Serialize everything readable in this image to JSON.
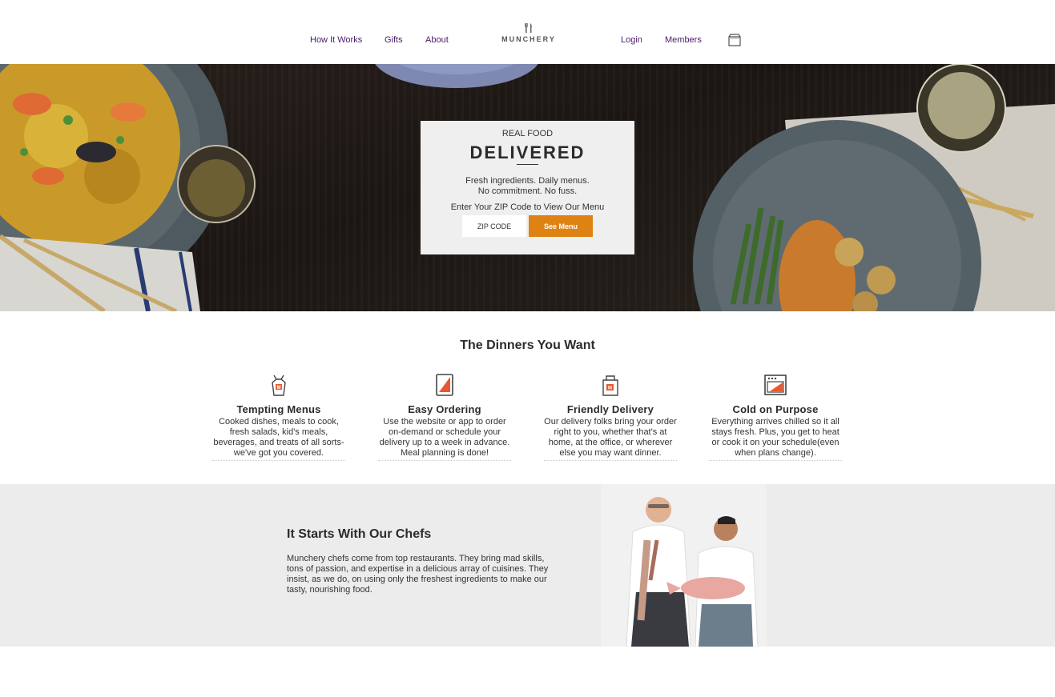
{
  "nav": {
    "left_links": [
      "How It Works",
      "Gifts",
      "About"
    ],
    "right_links": [
      "Login",
      "Members"
    ],
    "logo_text": "MUNCHERY",
    "cart_icon": "shopping-bag-icon"
  },
  "hero": {
    "kicker": "REAL FOOD",
    "headline": "DELIVERED",
    "tagline_1": "Fresh ingredients. Daily menus.",
    "tagline_2": "No commitment. No fuss.",
    "zip_prompt": "Enter Your ZIP Code to View Our Menu",
    "zip_placeholder": "ZIP CODE",
    "cta_label": "See Menu",
    "cta_color": "#de8214"
  },
  "dinners": {
    "title": "The Dinners You Want",
    "features": [
      {
        "icon": "apron-icon",
        "title": "Tempting Menus",
        "desc": "Cooked dishes, meals to cook, fresh salads, kid's meals, beverages, and treats of all sorts- we've got you covered."
      },
      {
        "icon": "tablet-icon",
        "title": "Easy Ordering",
        "desc": "Use the website or app to order on-demand or schedule your delivery up to a week in advance. Meal planning is done!"
      },
      {
        "icon": "delivery-bag-icon",
        "title": "Friendly Delivery",
        "desc": "Our delivery folks bring your order right to you, whether that's at home, at the office, or wherever else you may want dinner."
      },
      {
        "icon": "oven-icon",
        "title": "Cold on Purpose",
        "desc": "Everything arrives chilled so it all stays fresh. Plus, you get to heat or cook it on your schedule(even when plans change)."
      }
    ]
  },
  "chefs": {
    "title": "It Starts With Our Chefs",
    "body": "Munchery chefs come from top restaurants. They bring mad skills, tons of passion, and expertise in a delicious array of cuisines. They insist, as we do, on using only the freshest ingredients to make our tasty, nourishing food."
  },
  "colors": {
    "nav_link": "#4a1a6b",
    "accent": "#de8214",
    "icon_accent": "#e8572f",
    "chefs_bg": "#ececec"
  }
}
